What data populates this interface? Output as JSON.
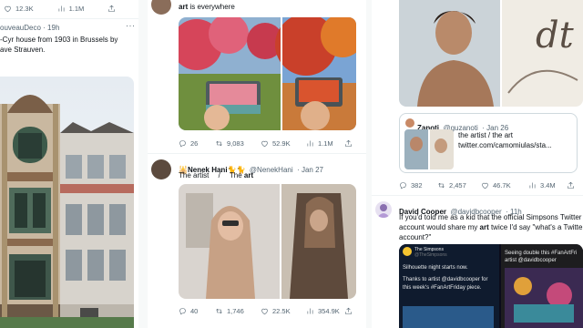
{
  "col1": {
    "stats": {
      "likes": "12.3K",
      "views": "1.1M"
    },
    "author_tail": "ouveauDeco",
    "time": "· 19h",
    "text_line1": "-Cyr house from 1903 in Brussels by",
    "text_line2": "ave Strauven."
  },
  "col2": {
    "tweet1": {
      "text_bold": "art",
      "text_rest": " is everywhere",
      "stats": {
        "replies": "26",
        "retweets": "9,083",
        "likes": "52.9K",
        "views": "1.1M"
      }
    },
    "tweet2": {
      "name": "Nenek Hani",
      "emoji_prefix": "🕌",
      "emoji_suffix": "🐈🐈",
      "handle": "@NenekHani",
      "time": "· Jan 27",
      "text_a": "The artist",
      "text_sep": "/",
      "text_b_prefix": "The ",
      "text_b_bold": "art",
      "stats": {
        "replies": "40",
        "retweets": "1,746",
        "likes": "22.5K",
        "views": "354.9K"
      }
    }
  },
  "col3": {
    "quote": {
      "name": "Zanoti",
      "handle": "@guzanoti",
      "time": "· Jan 26",
      "line1": "the artist / the art",
      "line2": "twitter.com/camomiulas/sta..."
    },
    "stats": {
      "replies": "382",
      "retweets": "2,457",
      "likes": "46.7K",
      "views": "3.4M"
    },
    "tweet2": {
      "name": "David Cooper",
      "handle": "@davidbcooper",
      "time": "· 11h",
      "line1": "If you'd told me as a kid that the official Simpsons Twitter",
      "line2_a": "account would share my ",
      "line2_bold": "art",
      "line2_b": " twice I'd say \"what's a Twitte",
      "line3": "account?\"",
      "embed": {
        "account": "The Simpsons",
        "handle": "@TheSimpsons",
        "line1": "Silhouette night starts now.",
        "line2": "Thanks to artist @davidbcooper for",
        "line3": "this week's #FanArtFriday piece.",
        "right1": "Seeing double this #FanArtFri",
        "right2": "artist @davidbcooper"
      }
    }
  },
  "colors": {
    "accent": "#1d9bf0",
    "muted": "#536471",
    "border": "#eff3f4"
  }
}
